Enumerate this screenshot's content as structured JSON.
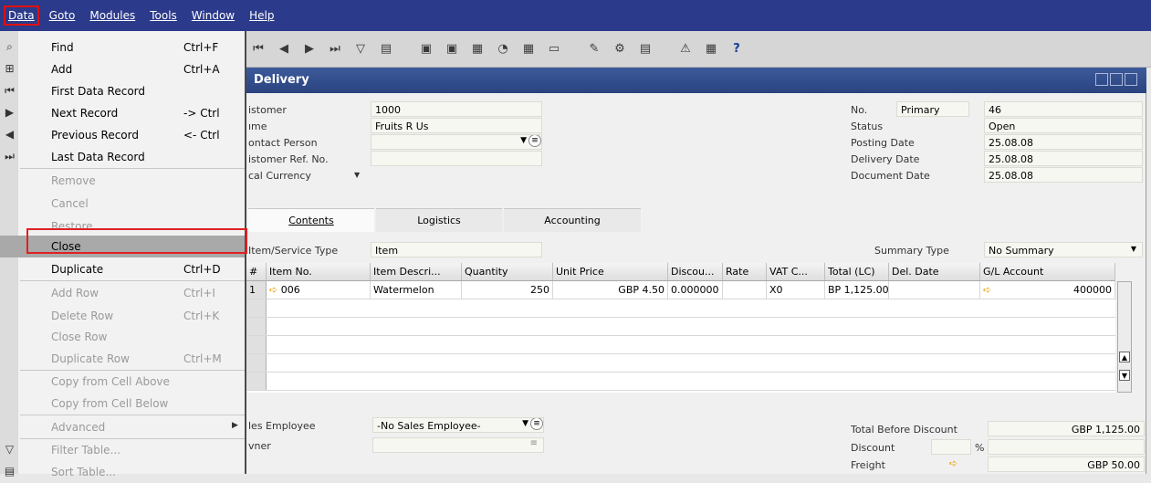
{
  "menubar": {
    "items": [
      "Data",
      "Goto",
      "Modules",
      "Tools",
      "Window",
      "Help"
    ]
  },
  "window": {
    "title": "Delivery"
  },
  "header": {
    "customer_label": "istomer",
    "customer_value": "1000",
    "name_label": "ıme",
    "name_value": "Fruits R Us",
    "contact_label": "ontact Person",
    "ref_label": "istomer Ref. No.",
    "currency_label": "cal Currency",
    "no_label": "No.",
    "no_series": "Primary",
    "no_value": "46",
    "status_label": "Status",
    "status_value": "Open",
    "posting_label": "Posting Date",
    "posting_value": "25.08.08",
    "delivery_label": "Delivery Date",
    "delivery_value": "25.08.08",
    "document_label": "Document Date",
    "document_value": "25.08.08"
  },
  "tabs": [
    "Contents",
    "Logistics",
    "Accounting"
  ],
  "contents": {
    "item_type_label": "Item/Service Type",
    "item_type_value": "Item",
    "summary_label": "Summary Type",
    "summary_value": "No Summary",
    "columns": [
      "#",
      "Item No.",
      "Item Descri...",
      "Quantity",
      "Unit Price",
      "Discou...",
      "Rate",
      "VAT C...",
      "Total (LC)",
      "Del. Date",
      "G/L Account"
    ],
    "row1": {
      "num": "1",
      "item_no": "006",
      "desc": "Watermelon",
      "qty": "250",
      "price": "GBP 4.50",
      "discount": "0.000000",
      "vat": "X0",
      "total": "BP 1,125.00",
      "gl": "400000"
    }
  },
  "footer": {
    "sales_emp_label": "les Employee",
    "sales_emp_value": "-No Sales Employee-",
    "owner_label": "vner",
    "total_before_label": "Total Before Discount",
    "total_before_value": "GBP 1,125.00",
    "discount_label": "Discount",
    "discount_pct": "%",
    "freight_label": "Freight",
    "freight_value": "GBP 50.00"
  },
  "dropdown": {
    "items": [
      {
        "label": "Find",
        "shortcut": "Ctrl+F",
        "enabled": true,
        "icon": "binoculars-icon"
      },
      {
        "label": "Add",
        "shortcut": "Ctrl+A",
        "enabled": true,
        "icon": "add-icon"
      },
      {
        "label": "First Data Record",
        "shortcut": "",
        "enabled": true,
        "icon": "first-record-icon"
      },
      {
        "label": "Next Record",
        "shortcut": "-> Ctrl",
        "enabled": true,
        "icon": "next-record-icon"
      },
      {
        "label": "Previous Record",
        "shortcut": "<- Ctrl",
        "enabled": true,
        "icon": "previous-record-icon"
      },
      {
        "label": "Last Data Record",
        "shortcut": "",
        "enabled": true,
        "icon": "last-record-icon"
      },
      {
        "label": "Remove",
        "shortcut": "",
        "enabled": false
      },
      {
        "label": "Cancel",
        "shortcut": "",
        "enabled": false
      },
      {
        "label": "Restore",
        "shortcut": "",
        "enabled": false
      },
      {
        "label": "Close",
        "shortcut": "",
        "enabled": true
      },
      {
        "label": "Duplicate",
        "shortcut": "Ctrl+D",
        "enabled": true
      },
      {
        "label": "Add Row",
        "shortcut": "Ctrl+I",
        "enabled": false
      },
      {
        "label": "Delete Row",
        "shortcut": "Ctrl+K",
        "enabled": false
      },
      {
        "label": "Close Row",
        "shortcut": "",
        "enabled": false
      },
      {
        "label": "Duplicate Row",
        "shortcut": "Ctrl+M",
        "enabled": false
      },
      {
        "label": "Copy from Cell Above",
        "shortcut": "",
        "enabled": false
      },
      {
        "label": "Copy from Cell Below",
        "shortcut": "",
        "enabled": false
      },
      {
        "label": "Advanced",
        "shortcut": "",
        "enabled": false
      },
      {
        "label": "Filter Table...",
        "shortcut": "",
        "enabled": false,
        "icon": "filter-icon"
      },
      {
        "label": "Sort Table...",
        "shortcut": "",
        "enabled": false,
        "icon": "sort-icon"
      }
    ]
  },
  "colors": {
    "menubar": "#2b3a8a",
    "titlebar": "#2a4380",
    "highlight": "#e02020"
  }
}
